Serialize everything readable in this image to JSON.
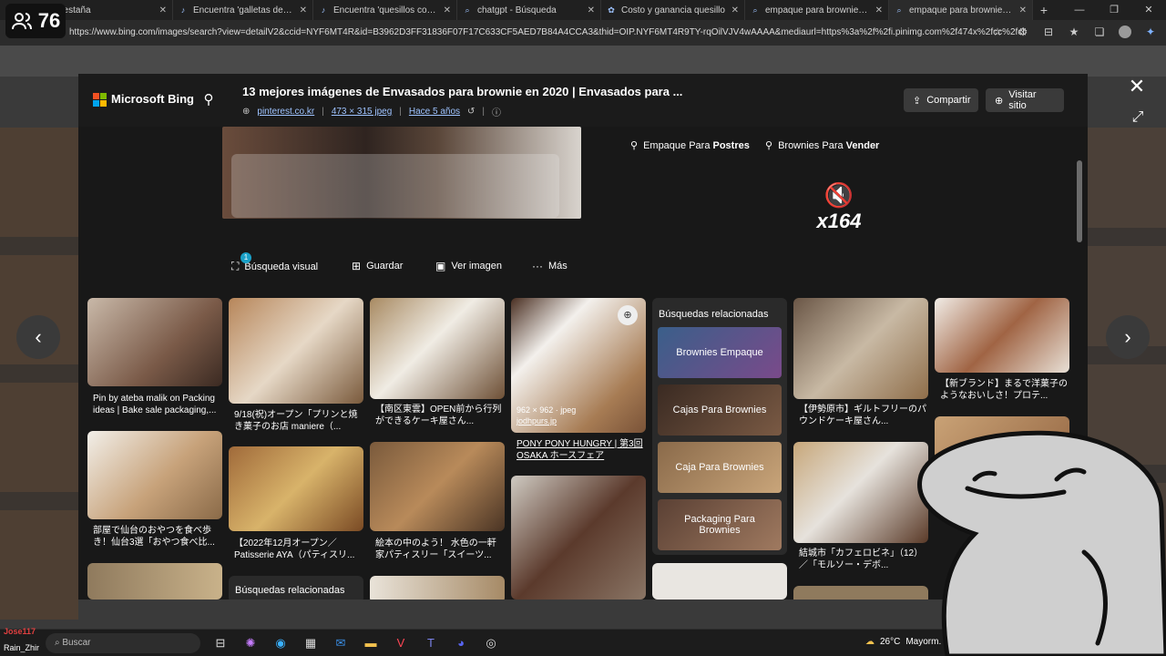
{
  "viewer_count": "76",
  "tabs": [
    {
      "title": "pestaña",
      "icon": "page-icon"
    },
    {
      "title": "Encuentra 'galletas de mantequill",
      "icon": "tiktok-icon"
    },
    {
      "title": "Encuentra 'quesillos como hacer'",
      "icon": "tiktok-icon"
    },
    {
      "title": "chatgpt - Búsqueda",
      "icon": "search-icon"
    },
    {
      "title": "Costo y ganancia quesillo",
      "icon": "openai-icon"
    },
    {
      "title": "empaque para brownie - Búsque",
      "icon": "search-icon"
    },
    {
      "title": "empaque para brownie - Búsque",
      "icon": "search-icon"
    }
  ],
  "address": {
    "url": "https://www.bing.com/images/search?view=detailV2&ccid=NYF6MT4R&id=B3962D3FF31836F07F17C633CF5AED7B84A4CCA3&thid=OIP.NYF6MT4R9TY-rqOilVJV4wAAAA&mediaurl=https%3a%2f%2fi.pinimg.com%2f474x%2fcc%2fcb%2f40%..."
  },
  "modal": {
    "brand": "Microsoft Bing",
    "title": "13 mejores imágenes de Envasados para brownie en 2020 | Envasados para ...",
    "source": "pinterest.co.kr",
    "dimensions": "473 × 315 jpeg",
    "age": "Hace 5 años",
    "share_label": "Compartir",
    "visit_label": "Visitar sitio",
    "related_chip1": {
      "prefix": "Empaque Para ",
      "bold": "Postres"
    },
    "related_chip2": {
      "prefix": "Brownies Para ",
      "bold": "Vender"
    },
    "mute_number": "x164",
    "actions": {
      "visual_search": "Búsqueda visual",
      "visual_badge": "1",
      "save": "Guardar",
      "view_image": "Ver imagen",
      "more": "Más"
    }
  },
  "results": {
    "captions": [
      "Pin by ateba malik on Packing ideas | Bake sale packaging,...",
      "9/18(祝)オープン「プリンと焼き菓子のお店 maniere（...",
      "【南区東雲】OPEN前から行列ができるケーキ屋さん...",
      "【伊勢原市】ギルトフリーのパウンドケーキ屋さん...",
      "【新ブランド】まるで洋菓子のようなおいしさ！プロテ...",
      "部屋で仙台のおやつを食べ歩き！仙台3選「おやつ食べ比...",
      "【2022年12月オープン／Patisserie AYA（パティスリ...",
      "絵本の中のよう！ 水色の一軒家パティスリー「スイーツ...",
      "結城市「カフェロビネ」（12）／「モルソー・デボ..."
    ],
    "image_info": {
      "size": "962 × 962 · jpeg",
      "source": "jodhpurs.jp"
    },
    "pony_link": "PONY PONY HUNGRY | 第3回OSAKA ホースフェア",
    "related_header": "Búsquedas relacionadas",
    "related_tiles": [
      "Brownies Empaque",
      "Cajas Para Brownies",
      "Caja Para Brownies",
      "Packaging Para Brownies"
    ],
    "related_header2": "Búsquedas relacionadas"
  },
  "taskbar": {
    "search_placeholder": "Buscar",
    "weather": "26°C",
    "weather_desc": "Mayorm."
  },
  "chat": {
    "user1": "Jose117",
    "user2": "Rain_Zhir"
  }
}
